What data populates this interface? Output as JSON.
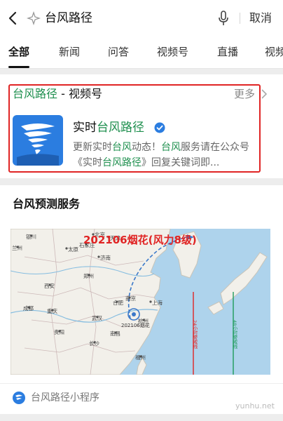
{
  "search": {
    "query": "台风路径",
    "cancel_label": "取消"
  },
  "tabs": [
    {
      "label": "全部",
      "active": true
    },
    {
      "label": "新闻"
    },
    {
      "label": "问答"
    },
    {
      "label": "视频号"
    },
    {
      "label": "直播"
    },
    {
      "label": "视频"
    }
  ],
  "channel_section": {
    "title_highlight": "台风路径",
    "title_suffix": " - 视频号",
    "more_label": "更多",
    "account": {
      "name_prefix": "实时",
      "name_highlight": "台风路径",
      "desc_parts": [
        "更新实时",
        "台风",
        "动态！",
        "台风",
        "服务请在公众号《实时",
        "台风路径",
        "》回复关键词即..."
      ]
    }
  },
  "service_section": {
    "title": "台风预测服务",
    "map_headline": "202106烟花(风力8级)",
    "map_labels": {
      "beijing": "北京",
      "tianjin": "天津",
      "shijiazhuang": "石家庄",
      "taiyuan": "太原",
      "jinan": "济南",
      "zhengzhou": "郑州",
      "xian": "西安",
      "hefei": "合肥",
      "nanjing": "南京",
      "shanghai": "上海",
      "wuhan": "武汉",
      "changsha": "长沙",
      "nanchang": "南昌",
      "guiyang": "贵阳",
      "fuzhou": "福州",
      "yinchuan": "银川",
      "lanzhou": "兰州",
      "chengdu": "成都",
      "chongqing": "重庆",
      "hangzhou": "杭州",
      "storm_tag": "202106烟花",
      "line24": "24小时警戒线",
      "line48": "48小时警戒线"
    },
    "mini_program_label": "台风路径小程序"
  },
  "watermark": "yunhu.net",
  "colors": {
    "highlight_green": "#1e8f4e",
    "box_red": "#e02424",
    "warn_red": "#e02424",
    "warn_green": "#1e9b5b"
  }
}
